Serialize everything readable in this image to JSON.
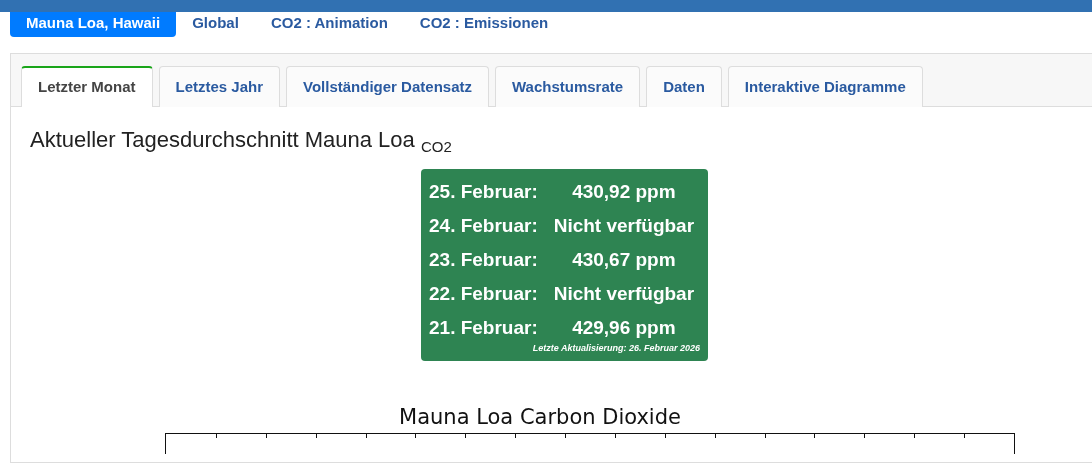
{
  "nav": [
    {
      "label": "Mauna Loa, Hawaii",
      "selected": true
    },
    {
      "label": "Global",
      "selected": false
    },
    {
      "label": "CO2 : Animation",
      "selected": false
    },
    {
      "label": "CO2 : Emissionen",
      "selected": false
    }
  ],
  "tabs": [
    {
      "label": "Letzter Monat",
      "selected": true
    },
    {
      "label": "Letztes Jahr",
      "selected": false
    },
    {
      "label": "Vollständiger Datensatz",
      "selected": false
    },
    {
      "label": "Wachstumsrate",
      "selected": false
    },
    {
      "label": "Daten",
      "selected": false
    },
    {
      "label": "Interaktive Diagramme",
      "selected": false
    }
  ],
  "heading": "Aktueller Tagesdurchschnitt Mauna Loa $_{CO2}$",
  "readings": [
    {
      "date": "25. Februar:",
      "value": "430,92 ppm"
    },
    {
      "date": "24. Februar:",
      "value": "Nicht verfügbar"
    },
    {
      "date": "23. Februar:",
      "value": "430,67 ppm"
    },
    {
      "date": "22. Februar:",
      "value": "Nicht verfügbar"
    },
    {
      "date": "21. Februar:",
      "value": "429,96 ppm"
    }
  ],
  "last_update": "Letzte Aktualisierung: 26. Februar 2026",
  "chart": {
    "title": "Mauna Loa Carbon Dioxide"
  }
}
